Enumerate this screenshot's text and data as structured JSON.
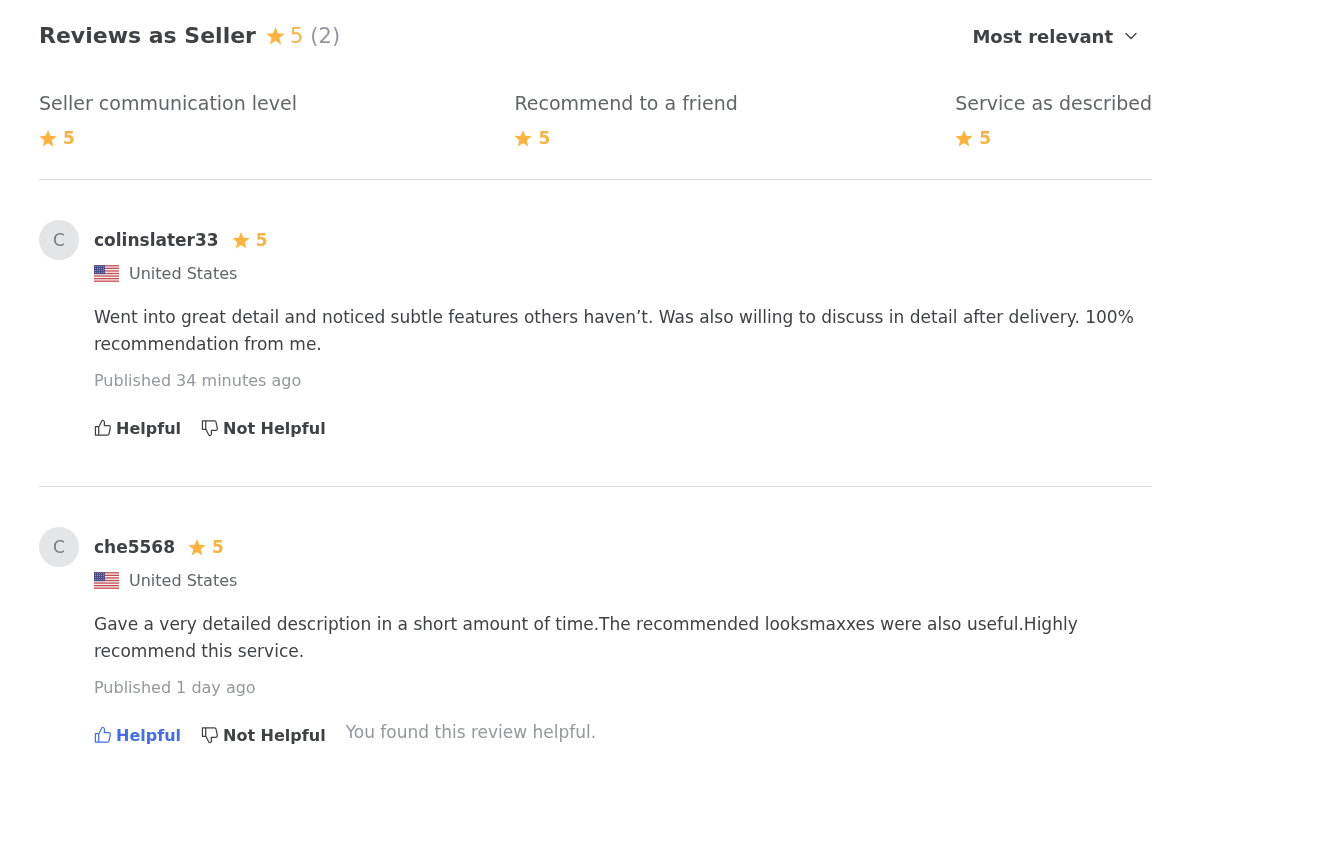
{
  "header": {
    "title": "Reviews as Seller",
    "rating": "5",
    "count": "(2)",
    "sort": {
      "label": "Most relevant"
    }
  },
  "categories": [
    {
      "label": "Seller communication level",
      "rating": "5"
    },
    {
      "label": "Recommend to a friend",
      "rating": "5"
    },
    {
      "label": "Service as described",
      "rating": "5"
    }
  ],
  "reviews": [
    {
      "avatar": "C",
      "username": "colinslater33",
      "rating": "5",
      "country": "United States",
      "text": "Went into great detail and noticed subtle features others haven’t. Was also willing to discuss in detail after delivery. 100% recommendation from me.",
      "published": "Published 34 minutes ago",
      "helpful": {
        "label": "Helpful",
        "selected": false
      },
      "not_helpful": {
        "label": "Not Helpful",
        "selected": false
      }
    },
    {
      "avatar": "C",
      "username": "che5568",
      "rating": "5",
      "country": "United States",
      "text": "Gave a very detailed description in a short amount of time.The recommended looksmaxxes were also useful.Highly recommend this service.",
      "published": "Published 1 day ago",
      "helpful": {
        "label": "Helpful",
        "selected": true
      },
      "not_helpful": {
        "label": "Not Helpful",
        "selected": false
      },
      "feedback": "You found this review helpful."
    }
  ]
}
